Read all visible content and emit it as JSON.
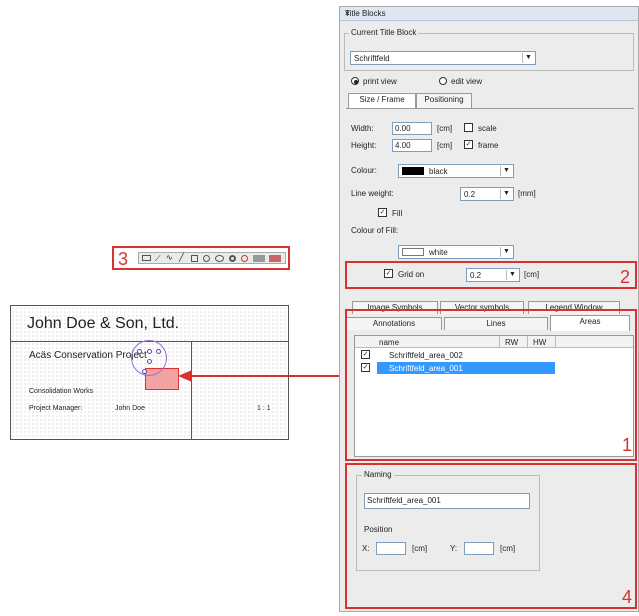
{
  "panel": {
    "title": "Title Blocks",
    "close": "×",
    "current_group_label": "Current Title Block",
    "current_value": "Schriftfeld",
    "view_print": "print view",
    "view_edit": "edit view",
    "tabs_top": [
      "Size / Frame",
      "Positioning"
    ],
    "width_label": "Width:",
    "width_value": "0.00",
    "width_unit": "[cm]",
    "scale_label": "scale",
    "height_label": "Height:",
    "height_value": "4.00",
    "height_unit": "[cm]",
    "frame_label": "frame",
    "colour_label": "Colour:",
    "colour_value": "black",
    "lineweight_label": "Line weight:",
    "lineweight_value": "0.2",
    "lineweight_unit": "[mm]",
    "fill_label": "Fill",
    "fill_colour_label": "Colour of Fill:",
    "fill_colour_value": "white",
    "grid_label": "Grid on",
    "grid_value": "0.2",
    "grid_unit": "[cm]",
    "tabs_row1": [
      "Image Symbols",
      "Vector symbols",
      "Legend Window"
    ],
    "tabs_row2": [
      "Annotations",
      "Lines",
      "Areas"
    ],
    "table_headers": [
      "name",
      "RW",
      "HW"
    ],
    "rows": [
      {
        "name": "Schriftfeld_area_002",
        "selected": false
      },
      {
        "name": "Schriftfeld_area_001",
        "selected": true
      }
    ],
    "naming_label": "Naming",
    "naming_value": "Schriftfeld_area_001",
    "position_label": "Position",
    "x_label": "X:",
    "x_unit": "[cm]",
    "y_label": "Y:",
    "y_unit": "[cm]"
  },
  "annotations": {
    "n1": "1",
    "n2": "2",
    "n3": "3",
    "n4": "4"
  },
  "title_block": {
    "company": "John Doe & Son, Ltd.",
    "project": "Acäs Conservation Project",
    "line1": "Consolidation Works",
    "line2_label": "Project Manager:",
    "line2_value": "John Doe",
    "scale": "1 : 1"
  },
  "colors": {
    "accent_red": "#d93030",
    "selection_blue": "#3399ff"
  }
}
